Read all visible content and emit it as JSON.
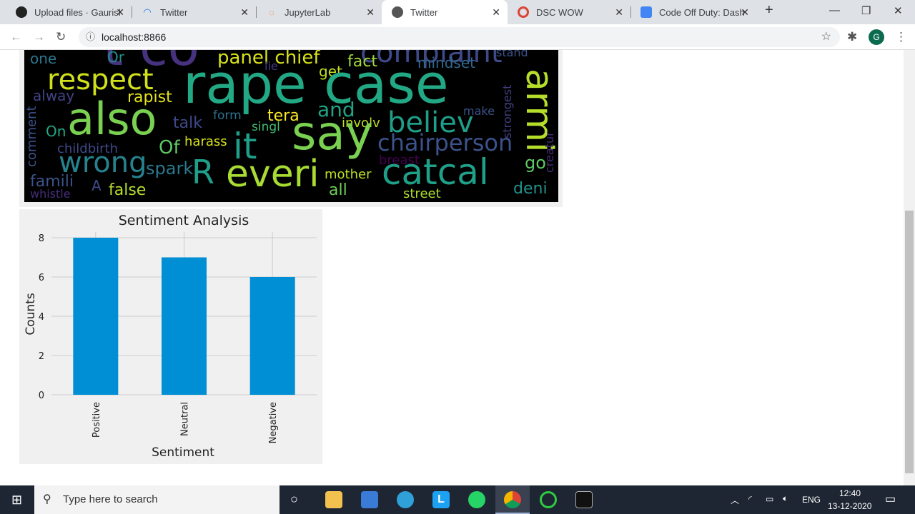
{
  "browser": {
    "tabs": [
      {
        "title": "Upload files · Gaurish",
        "icon": "github-icon"
      },
      {
        "title": "Twitter",
        "icon": "loading-icon"
      },
      {
        "title": "JupyterLab",
        "icon": "jupyter-icon"
      },
      {
        "title": "Twitter",
        "icon": "globe-icon",
        "active": true
      },
      {
        "title": "DSC WOW",
        "icon": "chrome-icon"
      },
      {
        "title": "Code Off Duty: Dash",
        "icon": "docs-icon"
      }
    ],
    "new_tab": "+",
    "url": "localhost:8866",
    "profile_initial": "G"
  },
  "wordcloud": {
    "words": [
      "t co",
      "complaint",
      "panel chief",
      "stand",
      "one",
      "Or",
      "lie",
      "get",
      "fact",
      "mindset",
      "respect",
      "rape case",
      "armi",
      "strongest",
      "alway",
      "rapist",
      "also",
      "comment",
      "talk",
      "form",
      "tera",
      "and",
      "make",
      "On",
      "singl",
      "involv",
      "believ",
      "say",
      "it",
      "creatur",
      "childbirth",
      "Of",
      "harass",
      "chairperson",
      "wrong",
      "spark",
      "breast",
      "go",
      "R",
      "everi",
      "mother",
      "catcal",
      "famili",
      "A",
      "false",
      "all",
      "deni",
      "whistle",
      "street"
    ]
  },
  "chart_data": {
    "type": "bar",
    "title": "Sentiment Analysis",
    "xlabel": "Sentiment",
    "ylabel": "Counts",
    "categories": [
      "Positive",
      "Neutral",
      "Negative"
    ],
    "values": [
      8,
      7,
      6
    ],
    "yticks": [
      0,
      2,
      4,
      6,
      8
    ],
    "ylim": [
      0,
      8.3
    ],
    "grid": true,
    "bar_color": "#008fd5",
    "background": "#f0f0f0"
  },
  "taskbar": {
    "search_placeholder": "Type here to search",
    "language": "ENG",
    "time": "12:40",
    "date": "13-12-2020"
  }
}
